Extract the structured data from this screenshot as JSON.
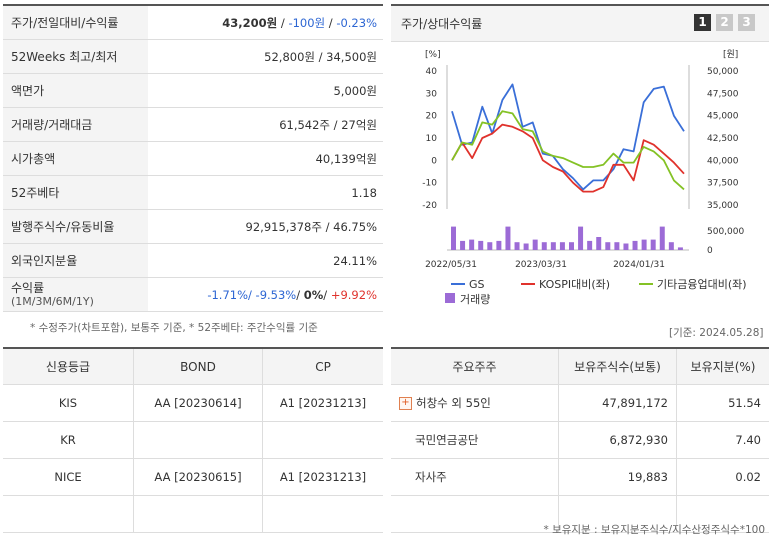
{
  "summary": {
    "rows": [
      {
        "label": "주가/전일대비/수익률"
      },
      {
        "label": "52Weeks 최고/최저",
        "value": "52,800원 / 34,500원"
      },
      {
        "label": "액면가",
        "value": "5,000원"
      },
      {
        "label": "거래량/거래대금",
        "value": "61,542주 / 27억원"
      },
      {
        "label": "시가총액",
        "value": "40,139억원"
      },
      {
        "label": "52주베타",
        "value": "1.18"
      },
      {
        "label": "발행주식수/유동비율",
        "value": "92,915,378주 / 46.75%"
      },
      {
        "label": "외국인지분율",
        "value": "24.11%"
      }
    ],
    "price": "43,200원",
    "sep1": " / ",
    "change": "-100원",
    "sep2": " / ",
    "change_rate": "-0.23%",
    "returns_label": "수익률",
    "returns_sub": "(1M/3M/6M/1Y)",
    "r1m": "-1.71%",
    "r3m": "-9.53%",
    "r6m": "0%",
    "r1y": "+9.92%",
    "slash": "/ ",
    "note": "* 수정주가(차트포함), 보통주 기준, * 52주베타: 주간수익률 기준"
  },
  "chart": {
    "title": "주가/상대수익률",
    "pages": [
      "1",
      "2",
      "3"
    ],
    "base_date": "[기준: 2024.05.28]"
  },
  "chart_data": {
    "type": "line",
    "left_unit": "[%]",
    "right_unit": "[원]",
    "left_ticks": [
      "40",
      "30",
      "20",
      "10",
      "0",
      "-10",
      "-20"
    ],
    "right_ticks": [
      "50,000",
      "47,500",
      "45,000",
      "42,500",
      "40,000",
      "37,500",
      "35,000"
    ],
    "volume_ticks": [
      "500,000",
      "0"
    ],
    "x_labels": [
      "2022/05/31",
      "2023/03/31",
      "2024/01/31"
    ],
    "ylim": [
      -20,
      40
    ],
    "series": [
      {
        "name": "GS",
        "color": "#3a6fd8",
        "values": [
          22,
          7,
          8,
          24,
          12,
          27,
          34,
          15,
          17,
          3,
          2,
          -4,
          -8,
          -13,
          -9,
          -9,
          -4,
          5,
          4,
          26,
          32,
          33,
          20,
          13
        ]
      },
      {
        "name": "KOSPI대비(좌)",
        "color": "#e0322c",
        "values": [
          0,
          8,
          1,
          10,
          12,
          16,
          15,
          13,
          10,
          0,
          -3,
          -5,
          -10,
          -14,
          -14,
          -12,
          -2,
          -2,
          -9,
          9,
          7,
          3,
          -1,
          -6
        ]
      },
      {
        "name": "기타금융업대비(좌)",
        "color": "#84c225",
        "values": [
          0,
          8,
          7,
          17,
          16,
          22,
          21,
          14,
          13,
          4,
          2,
          1,
          -1,
          -3,
          -3,
          -2,
          3,
          -1,
          -1,
          6,
          4,
          0,
          -9,
          -13
        ]
      }
    ],
    "volume": {
      "name": "거래량",
      "color": "#9c6bd6",
      "values": [
        0.9,
        0.35,
        0.4,
        0.35,
        0.3,
        0.35,
        0.9,
        0.3,
        0.25,
        0.4,
        0.3,
        0.3,
        0.3,
        0.3,
        0.9,
        0.35,
        0.5,
        0.3,
        0.3,
        0.25,
        0.35,
        0.4,
        0.4,
        0.9,
        0.3,
        0.1
      ]
    }
  },
  "credit": {
    "headers": [
      "신용등급",
      "BOND",
      "CP"
    ],
    "rows": [
      [
        "KIS",
        "AA  [20230614]",
        "A1  [20231213]"
      ],
      [
        "KR",
        "",
        ""
      ],
      [
        "NICE",
        "AA  [20230615]",
        "A1  [20231213]"
      ],
      [
        "",
        "",
        ""
      ]
    ]
  },
  "holders": {
    "headers": [
      "주요주주",
      "보유주식수(보통)",
      "보유지분(%)"
    ],
    "rows": [
      [
        "허창수 외 55인",
        "47,891,172",
        "51.54"
      ],
      [
        "국민연금공단",
        "6,872,930",
        "7.40"
      ],
      [
        "자사주",
        "19,883",
        "0.02"
      ],
      [
        "",
        "",
        ""
      ]
    ],
    "note": "* 보유지분 : 보유지분주식수/지수산정주식수*100"
  }
}
